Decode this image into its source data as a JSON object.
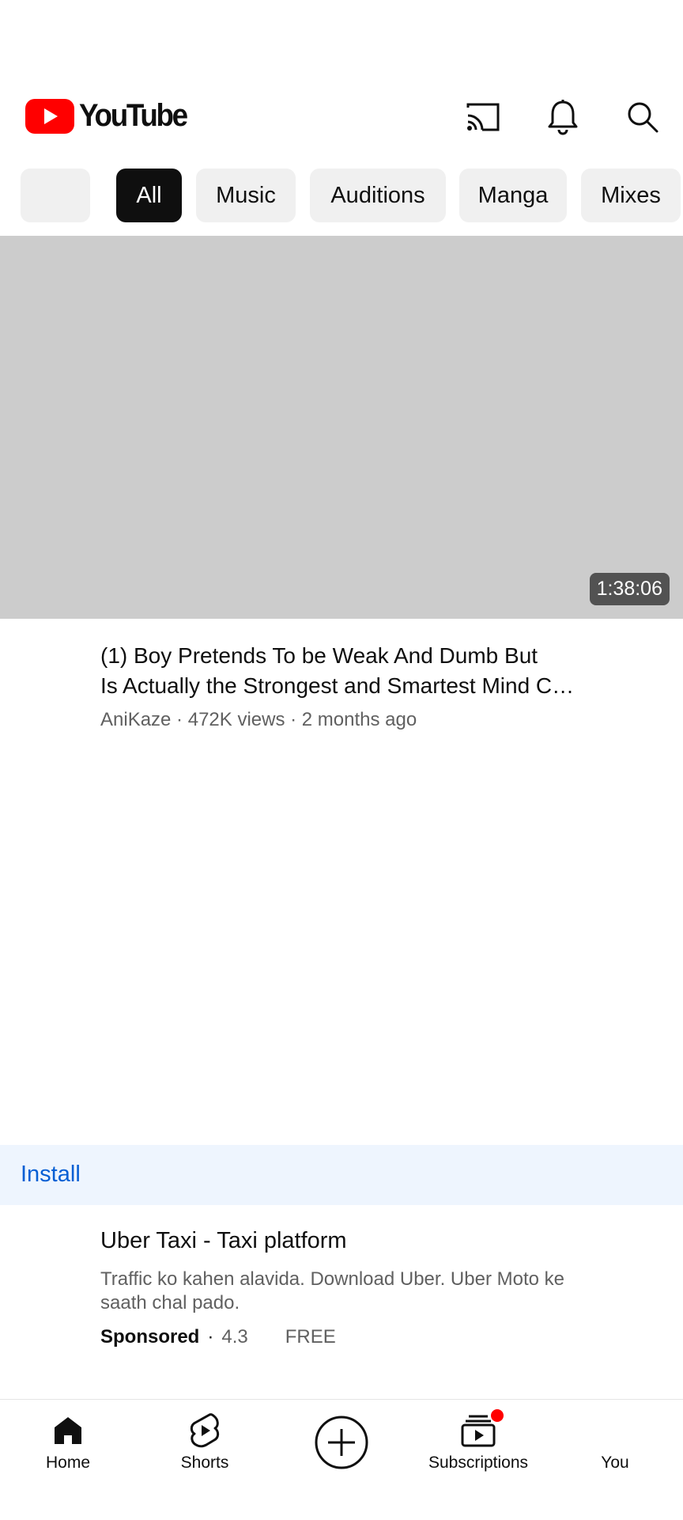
{
  "header": {
    "logo_text": "YouTube",
    "brand_red": "#ff0000",
    "icons": [
      "cast-icon",
      "bell-icon",
      "search-icon"
    ]
  },
  "chips": [
    {
      "label": ""
    },
    {
      "label": "All",
      "selected": true
    },
    {
      "label": "Music"
    },
    {
      "label": "Auditions"
    },
    {
      "label": "Manga"
    },
    {
      "label": "Mixes"
    }
  ],
  "video": {
    "duration": "1:38:06",
    "title_line1": "(1) Boy Pretends To be Weak And Dumb But",
    "title_line2": "Is Actually the Strongest and Smartest Mind C…",
    "meta": "AniKaze · 472K views · 2 months ago"
  },
  "ad": {
    "install_label": "Install",
    "title": "Uber Taxi - Taxi platform",
    "description": "Traffic ko kahen alavida. Download Uber. Uber Moto ke saath chal pado.",
    "sponsored": "Sponsored",
    "separator": "·",
    "rating": "4.3",
    "price": "FREE"
  },
  "nav": {
    "home": "Home",
    "shorts": "Shorts",
    "subscriptions": "Subscriptions",
    "you": "You",
    "notification_dot_color": "#ff0000"
  }
}
